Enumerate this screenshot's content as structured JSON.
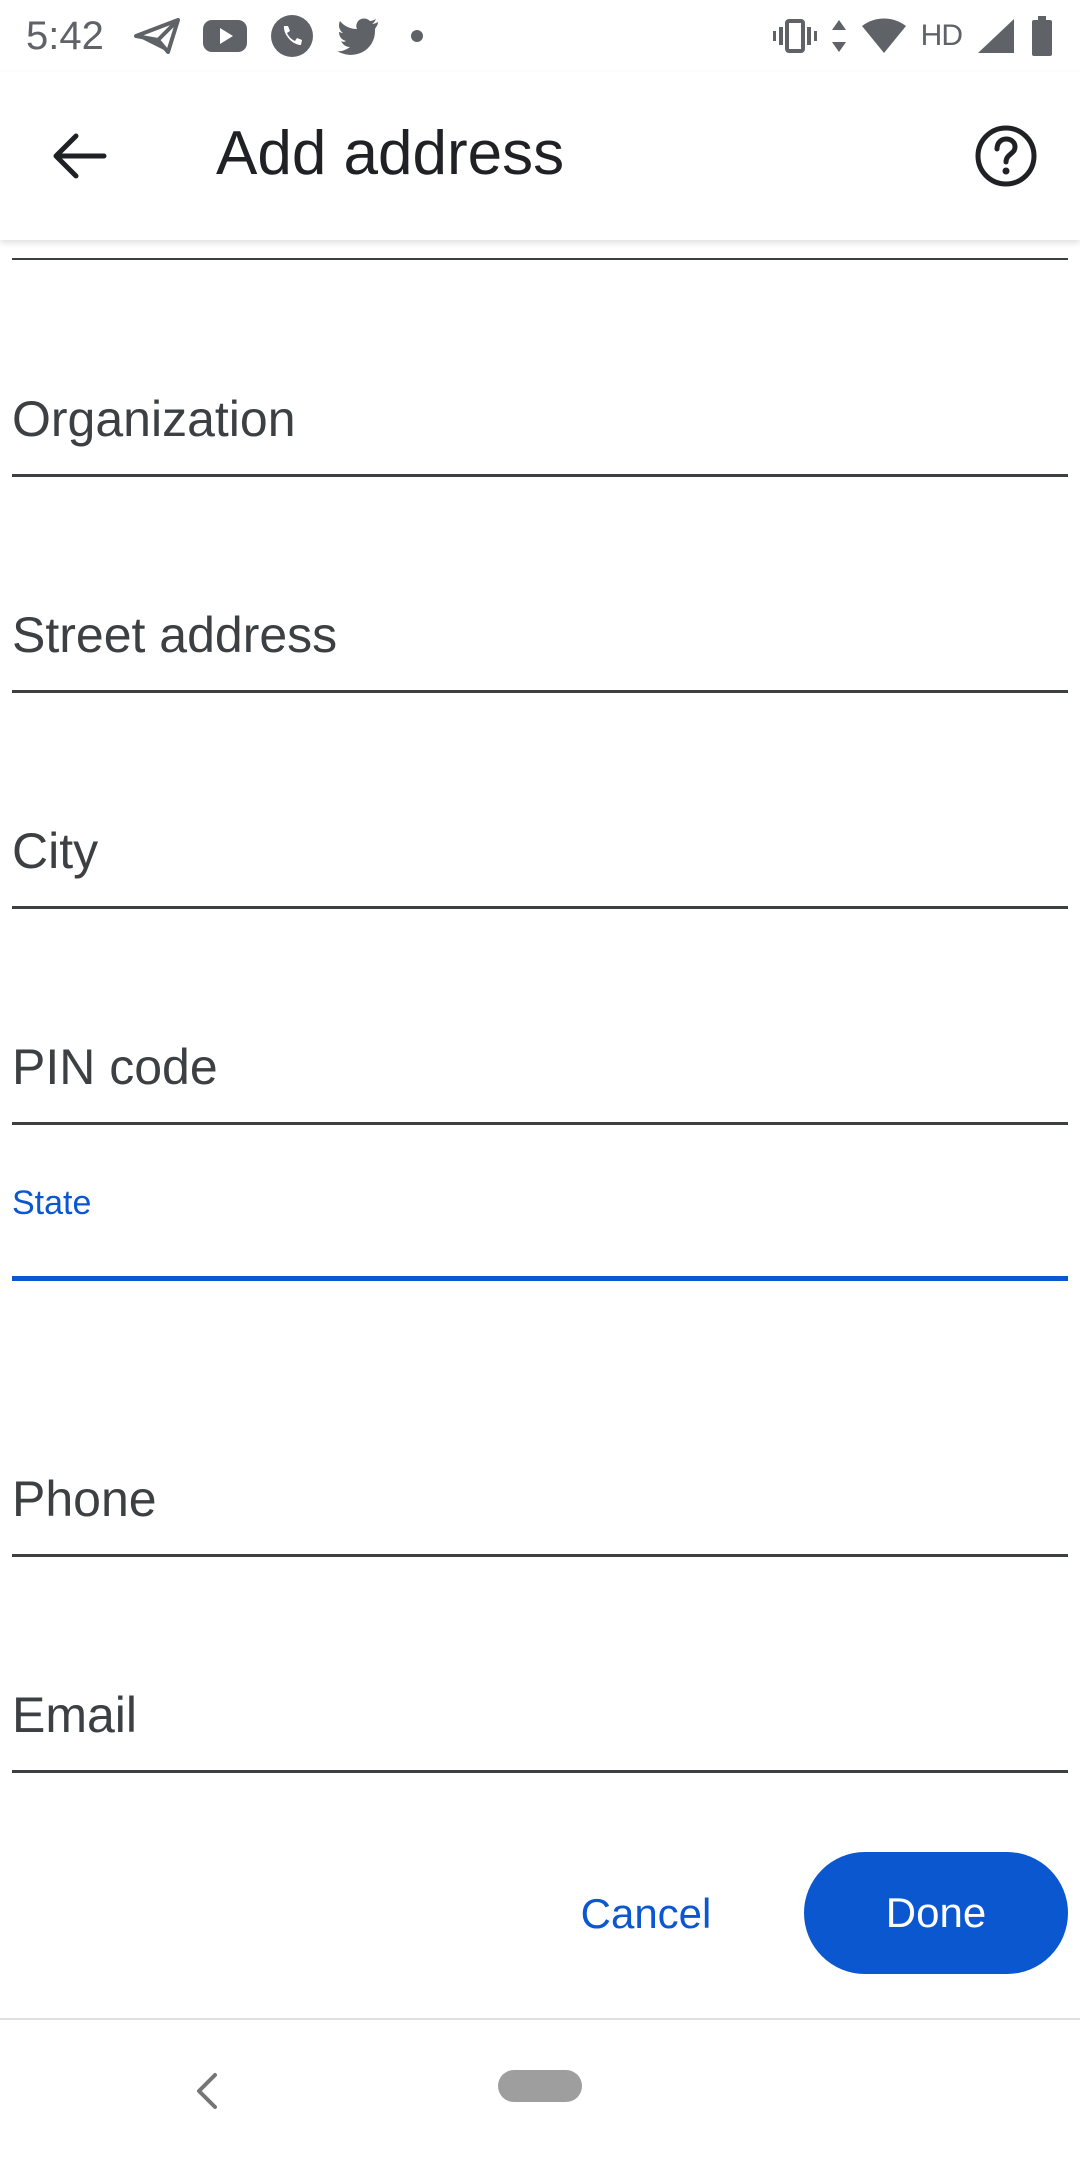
{
  "status_bar": {
    "time": "5:42",
    "left_icons": [
      "send-icon",
      "youtube-icon",
      "phone-icon",
      "twitter-icon",
      "dot-icon"
    ],
    "right_icons": [
      "vibrate-icon",
      "data-arrows-icon",
      "wifi-icon",
      "signal-icon",
      "battery-icon"
    ],
    "network_label": "HD"
  },
  "app_bar": {
    "title": "Add address",
    "back_icon": "arrow-back-icon",
    "help_icon": "help-circle-icon"
  },
  "form": {
    "fields": [
      {
        "label": "Organization",
        "value": "",
        "focused": false
      },
      {
        "label": "Street address",
        "value": "",
        "focused": false
      },
      {
        "label": "City",
        "value": "",
        "focused": false
      },
      {
        "label": "PIN code",
        "value": "",
        "focused": false
      },
      {
        "label": "State",
        "value": "",
        "focused": true
      },
      {
        "label": "Phone",
        "value": "",
        "focused": false
      },
      {
        "label": "Email",
        "value": "",
        "focused": false
      }
    ]
  },
  "actions": {
    "cancel_label": "Cancel",
    "done_label": "Done"
  },
  "nav_bar": {
    "back_icon": "nav-back-icon",
    "home_icon": "home-pill-icon"
  },
  "colors": {
    "accent": "#0b57d0",
    "text": "#202124",
    "label": "#3c4043",
    "status": "#5f6368"
  }
}
